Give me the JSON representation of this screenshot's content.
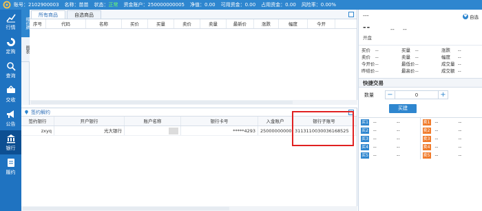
{
  "topbar": {
    "account": "账号：2102900003",
    "name": "名称：苗苗",
    "status_label": "状态：",
    "status_value": "正常",
    "fund_account": "资金账户：250000000005",
    "net_value": "净值：0.00",
    "available": "可用资金：0.00",
    "occupied": "占用资金：0.00",
    "risk_rate": "风险率：0.00%"
  },
  "nav": {
    "items": [
      {
        "label": "行情",
        "icon": "chart-icon"
      },
      {
        "label": "定购",
        "icon": "swirl-icon"
      },
      {
        "label": "查询",
        "icon": "search-gear-icon"
      },
      {
        "label": "交收",
        "icon": "delivery-icon"
      },
      {
        "label": "公告",
        "icon": "megaphone-icon"
      },
      {
        "label": "银行",
        "icon": "bank-icon"
      },
      {
        "label": "履约",
        "icon": "document-icon"
      }
    ],
    "active_index": 5
  },
  "vtabs": {
    "active": "报价牌",
    "inactive": "图表"
  },
  "market": {
    "tabs": [
      "所有商品",
      "自选商品"
    ],
    "columns": [
      "序号",
      "代码",
      "名称",
      "买价",
      "买量",
      "卖价",
      "卖量",
      "最新价",
      "涨跌",
      "幅度",
      "今开"
    ]
  },
  "signing": {
    "title": "签约解约",
    "columns": [
      "签约银行",
      "开户银行",
      "账户名称",
      "银行卡号",
      "入金账户",
      "银行子账号"
    ],
    "rows": [
      {
        "sign_bank": "zxyq",
        "open_bank": "光大银行",
        "account_name": "",
        "card_no": "*****4293",
        "deposit_account": "250000000005",
        "sub_account": "3113110030036168525"
      }
    ]
  },
  "quote": {
    "name": "---",
    "price": "--",
    "change": "--",
    "change_pct": "--",
    "open_label": "开盘",
    "fav_label": "自选",
    "grid": [
      [
        "买价",
        "--",
        "买量",
        "--",
        "涨跌",
        "--"
      ],
      [
        "卖价",
        "--",
        "卖量",
        "--",
        "幅度",
        "--"
      ],
      [
        "今开价",
        "--",
        "最低价",
        "--",
        "成交量",
        "--"
      ],
      [
        "昨结价",
        "--",
        "最高价",
        "--",
        "成交额",
        "--"
      ]
    ]
  },
  "quick_trade": {
    "title": "快捷交易",
    "qty_label": "数量",
    "qty_value": "0",
    "minus": "−",
    "plus": "+",
    "buy_label": "买建"
  },
  "book": {
    "buy": [
      {
        "tag": "买1",
        "v1": "--",
        "v2": "--"
      },
      {
        "tag": "买2",
        "v1": "--",
        "v2": "--"
      },
      {
        "tag": "买3",
        "v1": "--",
        "v2": "--"
      },
      {
        "tag": "买4",
        "v1": "--",
        "v2": "--"
      },
      {
        "tag": "买5",
        "v1": "--",
        "v2": "--"
      }
    ],
    "sell": [
      {
        "tag": "卖1",
        "v1": "--",
        "v2": "--"
      },
      {
        "tag": "卖2",
        "v1": "--",
        "v2": "--"
      },
      {
        "tag": "卖3",
        "v1": "--",
        "v2": "--"
      },
      {
        "tag": "卖4",
        "v1": "--",
        "v2": "--"
      },
      {
        "tag": "卖5",
        "v1": "--",
        "v2": "--"
      }
    ]
  },
  "colors": {
    "primary": "#2e86cf",
    "nav": "#1f73c1",
    "nav_active": "#0d4f92",
    "highlight": "#e02020",
    "ok": "#6dff6d",
    "sell": "#f07a2a"
  }
}
